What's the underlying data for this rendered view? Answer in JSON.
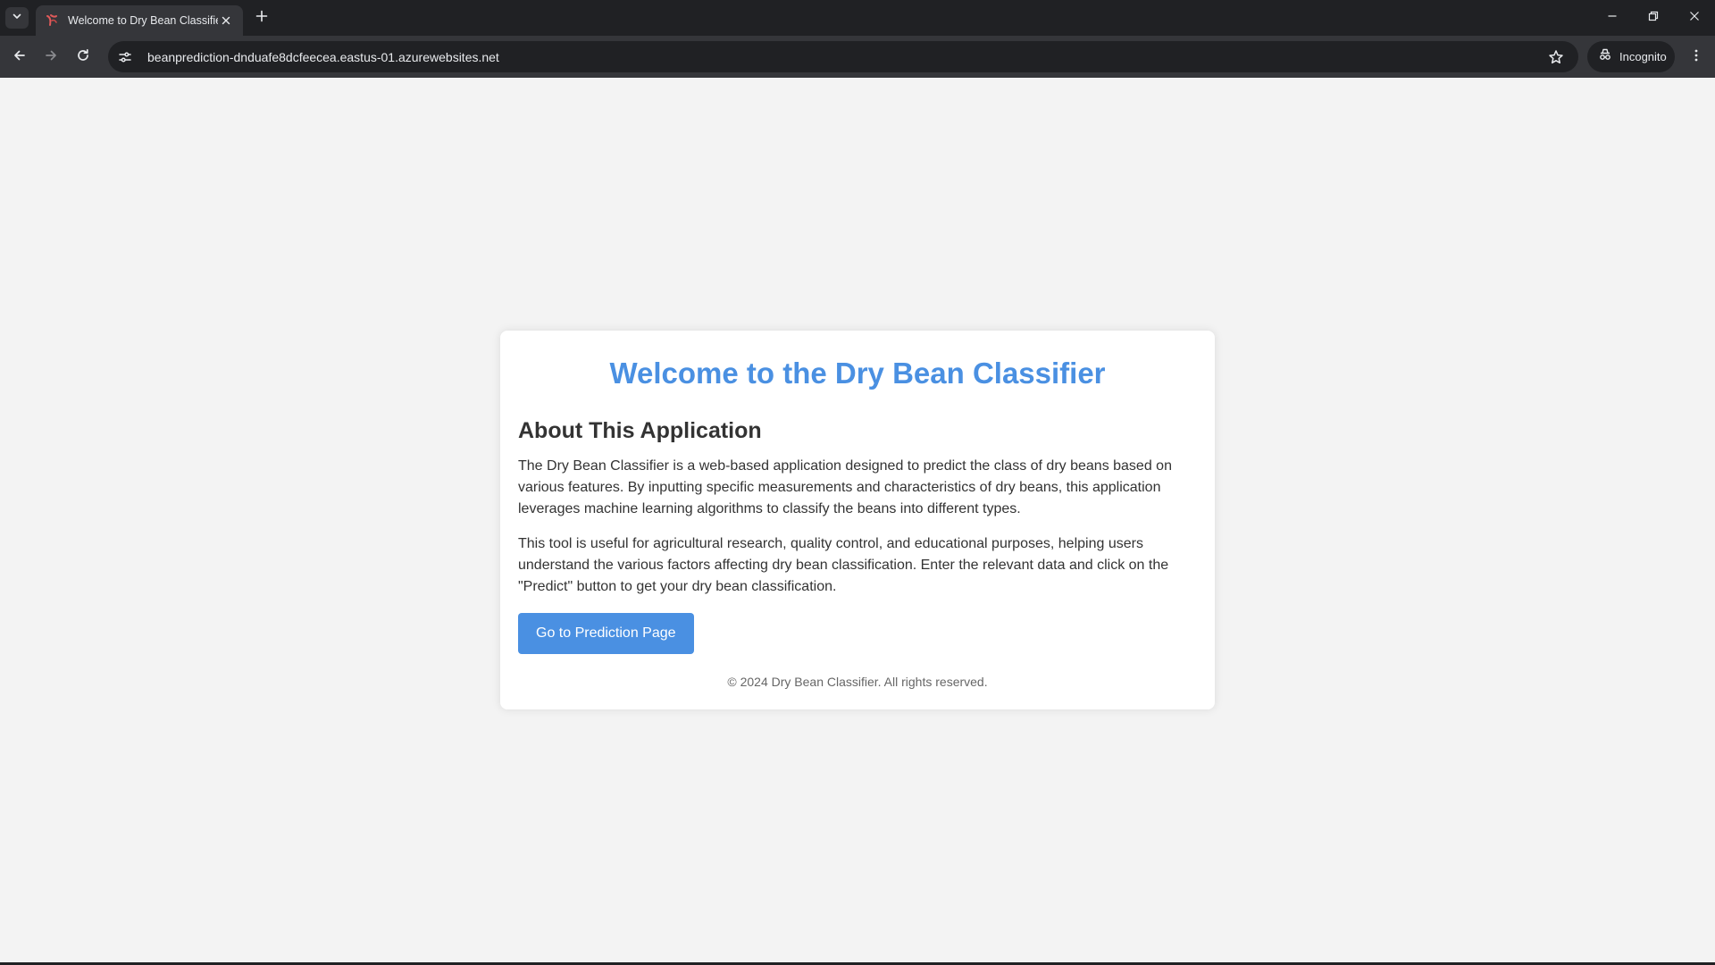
{
  "browser": {
    "tab": {
      "title": "Welcome to Dry Bean Classifier",
      "favicon": "bean-favicon-icon"
    },
    "address_bar": {
      "url": "beanprediction-dnduafe8dcfeecea.eastus-01.azurewebsites.net"
    },
    "profile": {
      "label": "Incognito"
    },
    "colors": {
      "frame": "#202124",
      "toolbar": "#35363a"
    }
  },
  "page": {
    "heading": "Welcome to the Dry Bean Classifier",
    "about": {
      "title": "About This Application",
      "paragraphs": [
        "The Dry Bean Classifier is a web-based application designed to predict the class of dry beans based on various features. By inputting specific measurements and characteristics of dry beans, this application leverages machine learning algorithms to classify the beans into different types.",
        "This tool is useful for agricultural research, quality control, and educational purposes, helping users understand the various factors affecting dry bean classification. Enter the relevant data and click on the \"Predict\" button to get your dry bean classification."
      ]
    },
    "cta_label": "Go to Prediction Page",
    "footer": "© 2024 Dry Bean Classifier. All rights reserved.",
    "colors": {
      "accent": "#4a90e2",
      "background": "#f3f3f3",
      "text": "#333333"
    }
  }
}
